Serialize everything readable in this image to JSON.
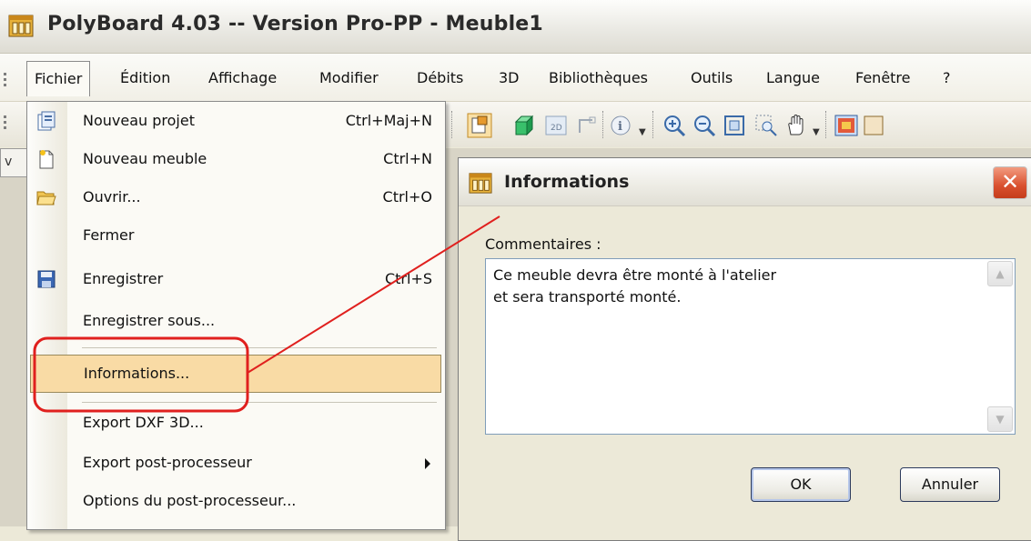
{
  "window": {
    "title": "PolyBoard 4.03 -- Version Pro-PP - Meuble1"
  },
  "menubar": {
    "items": [
      "Fichier",
      "Édition",
      "Affichage",
      "Modifier",
      "Débits",
      "3D",
      "Bibliothèques",
      "Outils",
      "Langue",
      "Fenêtre",
      "?"
    ]
  },
  "doc_tab_label": "v",
  "file_menu": {
    "items": [
      {
        "label": "Nouveau projet",
        "shortcut": "Ctrl+Maj+N",
        "icon": "new-project-icon"
      },
      {
        "label": "Nouveau meuble",
        "shortcut": "Ctrl+N",
        "icon": "new-furniture-icon"
      },
      {
        "label": "Ouvrir...",
        "shortcut": "Ctrl+O",
        "icon": "open-folder-icon"
      },
      {
        "label": "Fermer",
        "shortcut": ""
      },
      {
        "label": "Enregistrer",
        "shortcut": "Ctrl+S",
        "icon": "save-disk-icon"
      },
      {
        "label": "Enregistrer sous...",
        "shortcut": ""
      },
      {
        "label": "Informations...",
        "shortcut": "",
        "highlighted": true
      },
      {
        "label": "Export DXF 3D...",
        "shortcut": ""
      },
      {
        "label": "Export post-processeur",
        "shortcut": "",
        "submenu": true
      },
      {
        "label": "Options du post-processeur...",
        "shortcut": ""
      }
    ]
  },
  "dialog": {
    "title": "Informations",
    "comment_label": "Commentaires :",
    "comment_text": "Ce meuble devra être monté à l'atelier\net sera transporté monté.",
    "ok_label": "OK",
    "cancel_label": "Annuler",
    "close_glyph": "✕"
  },
  "colors": {
    "highlight": "#f9dba5",
    "annotation": "#e0201e",
    "close_button": "#d9502f"
  }
}
